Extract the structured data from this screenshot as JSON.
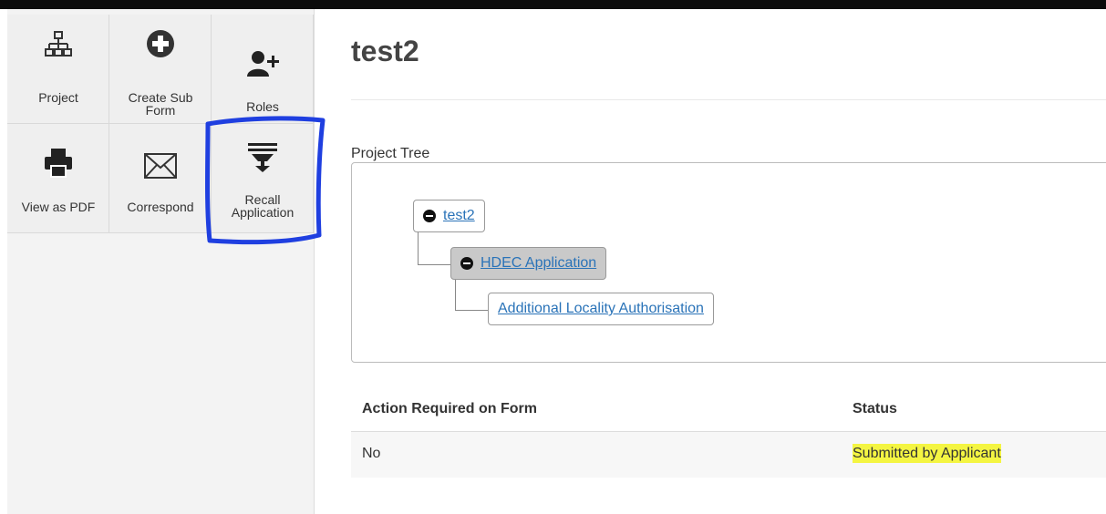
{
  "sidebar": {
    "tiles": [
      {
        "label": "Project",
        "icon": "sitemap-icon"
      },
      {
        "label": "Create Sub\nForm",
        "icon": "plus-circle-icon"
      },
      {
        "label": "Roles",
        "icon": "add-user-icon"
      },
      {
        "label": "View as PDF",
        "icon": "printer-icon"
      },
      {
        "label": "Correspond",
        "icon": "envelope-icon"
      },
      {
        "label": "Recall\nApplication",
        "icon": "recall-icon"
      }
    ]
  },
  "main": {
    "title": "test2",
    "tree_label": "Project Tree",
    "tree": {
      "root": "test2",
      "child": "HDEC Application",
      "grandchild": "Additional Locality Authorisation"
    },
    "table": {
      "headers": [
        "Action Required on Form",
        "Status"
      ],
      "rows": [
        [
          "No",
          "Submitted by Applicant"
        ]
      ]
    }
  },
  "colors": {
    "highlight": "#f4f542",
    "annotation": "#1f3fe0",
    "link": "#2a73b8"
  }
}
